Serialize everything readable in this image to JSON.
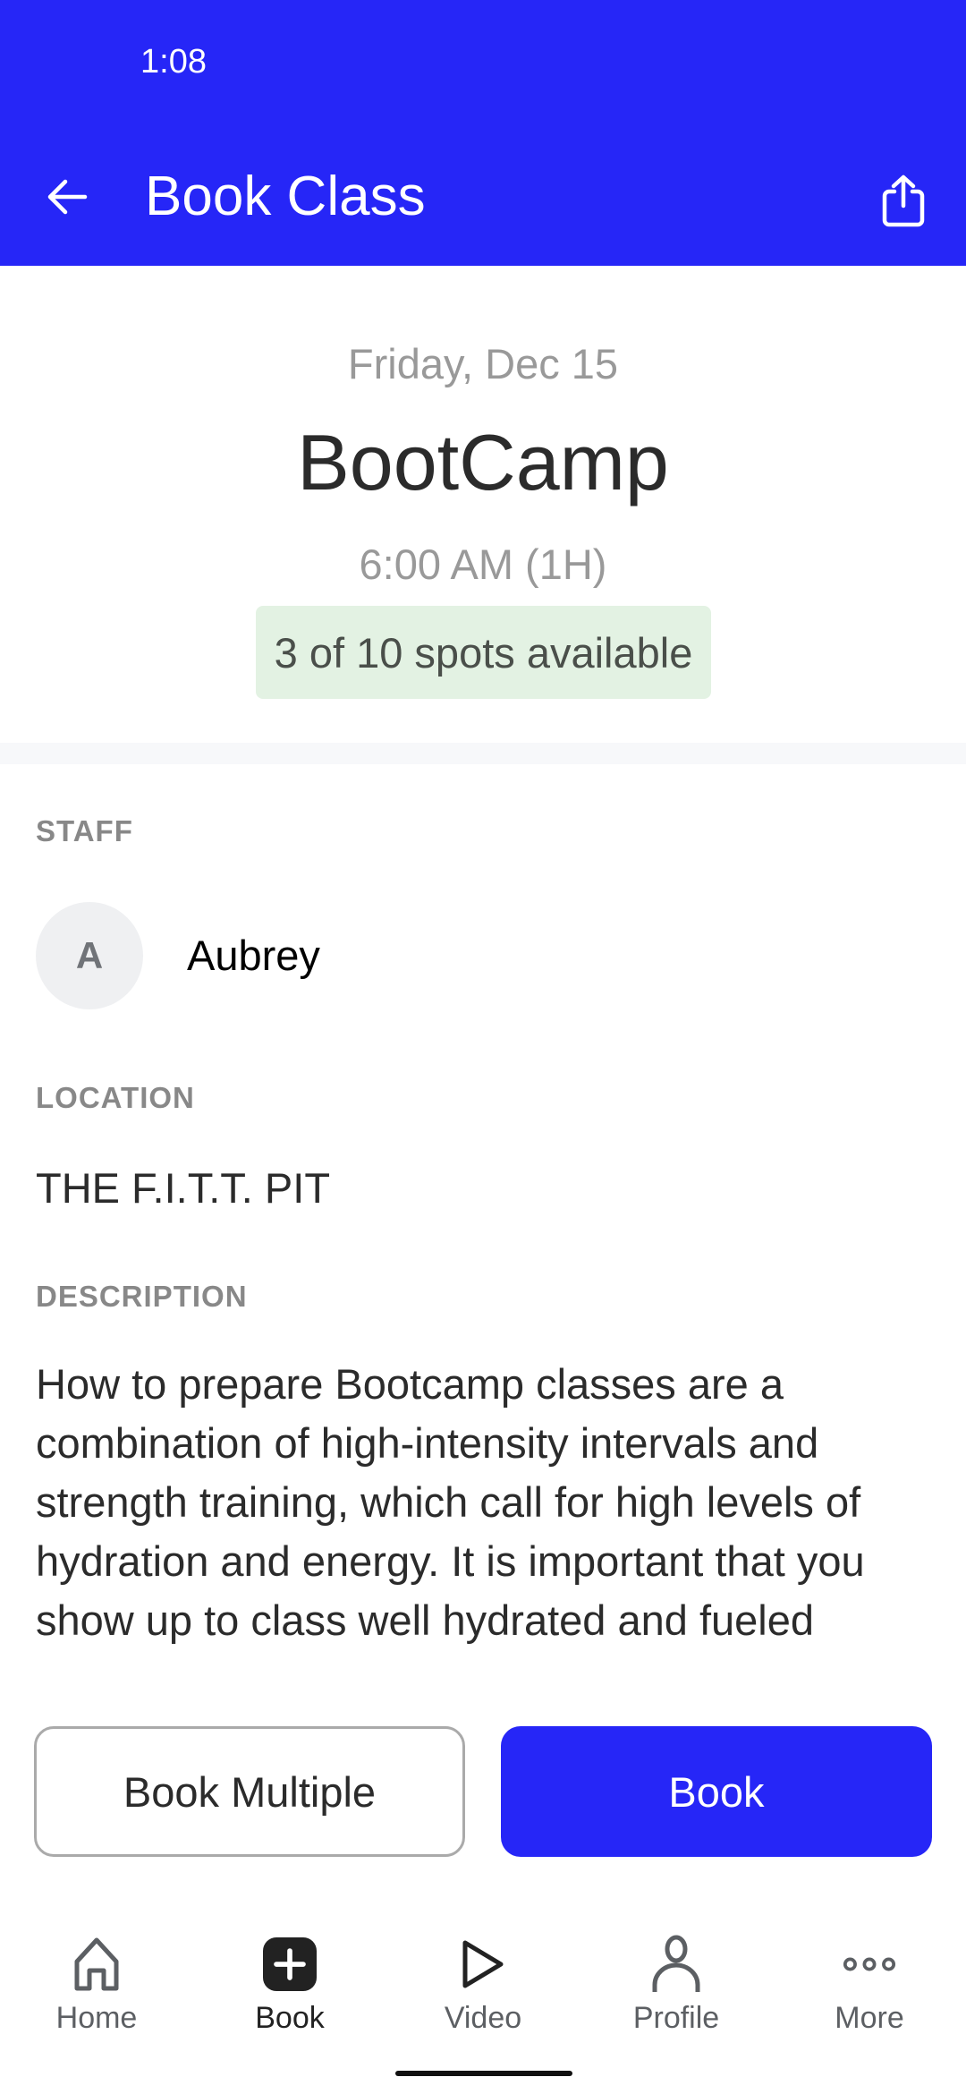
{
  "status_bar": {
    "time": "1:08"
  },
  "app_bar": {
    "title": "Book Class",
    "back_icon": "arrow-left-icon",
    "share_icon": "share-icon"
  },
  "class_info": {
    "date": "Friday, Dec 15",
    "name": "BootCamp",
    "time": "6:00 AM (1H)",
    "spots_text": "3 of 10 spots available",
    "spots_available": 3,
    "spots_total": 10
  },
  "staff": {
    "label": "STAFF",
    "avatar_initial": "A",
    "name": "Aubrey"
  },
  "location": {
    "label": "LOCATION",
    "value": "THE F.I.T.T. PIT"
  },
  "description": {
    "label": "DESCRIPTION",
    "text": "How to prepare Bootcamp classes are a combination of high-intensity intervals and strength training, which call for high levels of hydration and energy. It is important that you show up to class well hydrated and fueled"
  },
  "actions": {
    "book_multiple_label": "Book Multiple",
    "book_label": "Book"
  },
  "bottom_nav": {
    "items": [
      {
        "label": "Home",
        "icon": "home-icon",
        "active": false
      },
      {
        "label": "Book",
        "icon": "book-plus-icon",
        "active": true
      },
      {
        "label": "Video",
        "icon": "play-icon",
        "active": false
      },
      {
        "label": "Profile",
        "icon": "profile-icon",
        "active": false
      },
      {
        "label": "More",
        "icon": "more-icon",
        "active": false
      }
    ]
  },
  "colors": {
    "brand": "#2626f7",
    "badge_bg": "#e3f2e3",
    "label_grey": "#888888",
    "text": "#2b2b2b"
  }
}
